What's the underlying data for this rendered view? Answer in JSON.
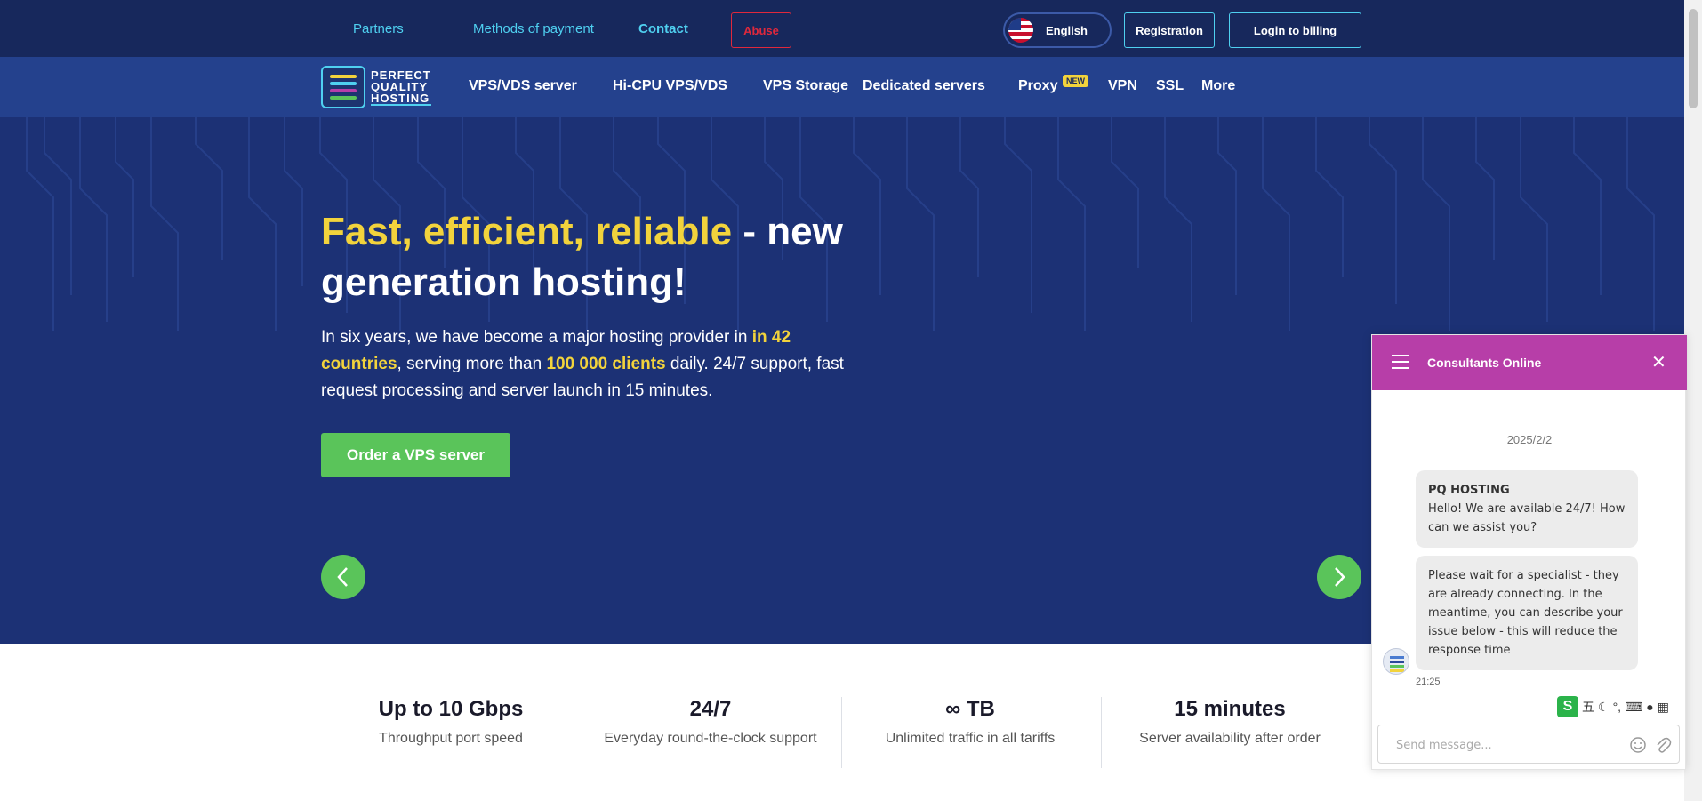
{
  "topbar": {
    "links": [
      "Partners",
      "Methods of payment",
      "Contact"
    ],
    "abuse_label": "Abuse",
    "language_label": "English",
    "registration_label": "Registration",
    "login_label": "Login to billing"
  },
  "logo": {
    "line1": "PERFECT",
    "line2": "QUALITY",
    "line3": "HOSTING"
  },
  "nav": {
    "items": [
      "VPS/VDS server",
      "Hi-CPU VPS/VDS",
      "VPS Storage",
      "Dedicated servers",
      "Proxy",
      "VPN",
      "SSL",
      "More"
    ],
    "new_badge": "NEW"
  },
  "hero": {
    "title_highlight": "Fast, efficient, reliable",
    "title_rest": " - new generation hosting!",
    "text_part1": "In six years, we have become a major hosting provider in ",
    "text_hl1": "in 42 countries",
    "text_part2": ", serving more than ",
    "text_hl2": "100 000 clients",
    "text_part3": " daily. 24/7 support, fast request processing and server launch in 15 minutes.",
    "button_label": "Order a VPS server"
  },
  "stats": [
    {
      "value": "Up to 10 Gbps",
      "label": "Throughput port speed"
    },
    {
      "value": "24/7",
      "label": "Everyday round-the-clock support"
    },
    {
      "value": "∞ TB",
      "label": "Unlimited traffic in all tariffs"
    },
    {
      "value": "15 minutes",
      "label": "Server availability after order"
    }
  ],
  "chat": {
    "title": "Consultants Online",
    "date": "2025/2/2",
    "sender": "PQ HOSTING",
    "message1": "Hello! We are available 24/7! How can we assist you?",
    "message2": "Please wait for a specialist - they are already connecting. In the meantime, you can describe your issue below - this will reduce the response time",
    "time": "21:25",
    "input_placeholder": "Send message...",
    "ime_glyph": "五"
  },
  "colors": {
    "topbar": "#17285c",
    "navbar": "#24418d",
    "hero": "#1c3175",
    "accent_yellow": "#f2d33c",
    "accent_green": "#5ac45a",
    "link_cyan": "#4fd0f0",
    "abuse_red": "#e0283c",
    "chat_header": "#b73ea8"
  },
  "icons": [
    "us-flag-icon",
    "chevron-left-icon",
    "chevron-right-icon",
    "menu-icon",
    "close-icon",
    "emoji-icon",
    "attach-icon",
    "keyboard-icon",
    "moon-icon",
    "user-icon",
    "grid-icon"
  ]
}
